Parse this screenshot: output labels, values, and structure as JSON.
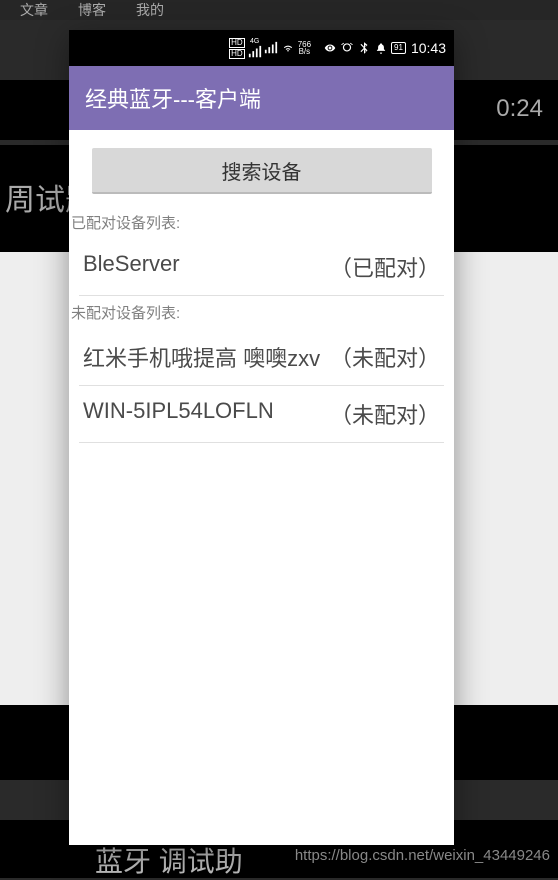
{
  "background": {
    "nav_items": [
      "文章",
      "博客",
      "我的"
    ],
    "timestamp_fragment": "0:24",
    "headline_fragment": "周试题",
    "bottom_text_fragment": "蓝牙 调试助"
  },
  "status_bar": {
    "hd_label": "HD",
    "signal_4g": "4G",
    "network_speed": "766",
    "network_unit": "B/s",
    "battery_level": "91",
    "time": "10:43"
  },
  "app": {
    "title": "经典蓝牙---客户端",
    "search_button": "搜索设备",
    "paired_section_label": "已配对设备列表:",
    "unpaired_section_label": "未配对设备列表:",
    "paired_devices": [
      {
        "name": "BleServer",
        "status": "（已配对）"
      }
    ],
    "unpaired_devices": [
      {
        "name": "红米手机哦提高 噢噢zxv",
        "status": "（未配对）"
      },
      {
        "name": "WIN-5IPL54LOFLN",
        "status": "（未配对）"
      }
    ]
  },
  "watermark": "https://blog.csdn.net/weixin_43449246"
}
